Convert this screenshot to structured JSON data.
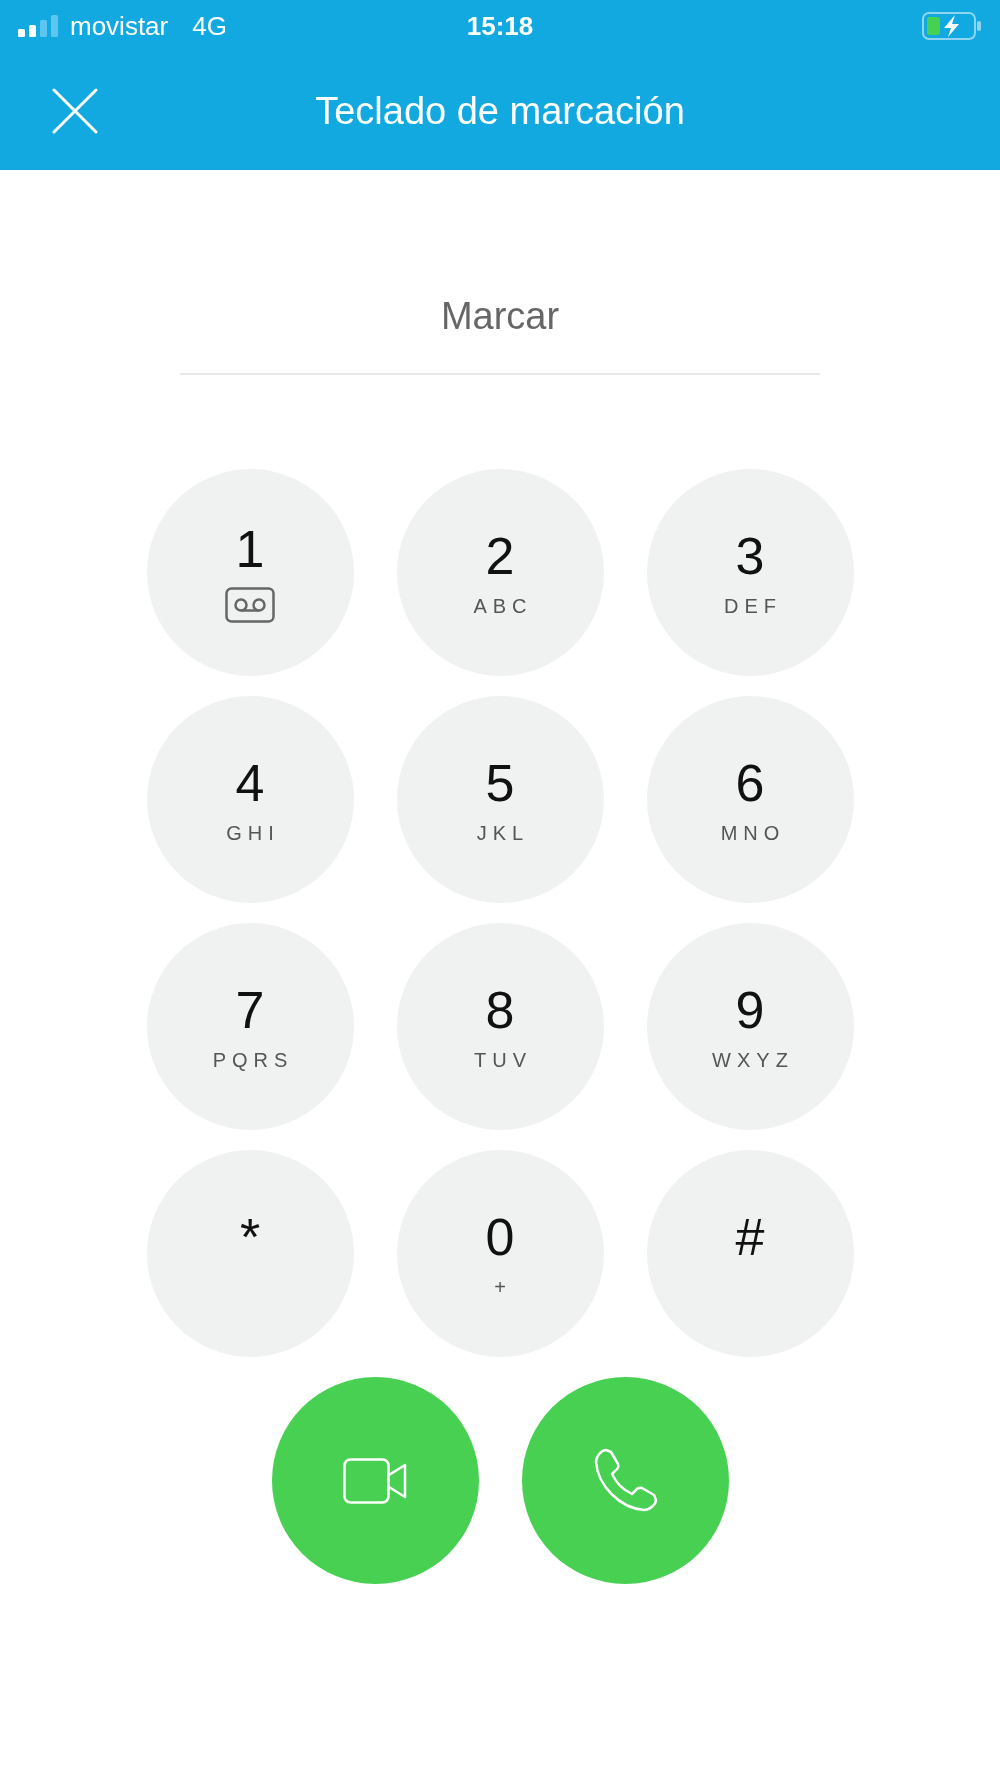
{
  "status_bar": {
    "carrier": "movistar",
    "network": "4G",
    "time": "15:18"
  },
  "header": {
    "title": "Teclado de marcación"
  },
  "dial_field": {
    "placeholder": "Marcar"
  },
  "keys": [
    {
      "digit": "1",
      "kind": "voicemail"
    },
    {
      "digit": "2",
      "kind": "letters",
      "sub": "ABC"
    },
    {
      "digit": "3",
      "kind": "letters",
      "sub": "DEF"
    },
    {
      "digit": "4",
      "kind": "letters",
      "sub": "GHI"
    },
    {
      "digit": "5",
      "kind": "letters",
      "sub": "JKL"
    },
    {
      "digit": "6",
      "kind": "letters",
      "sub": "MNO"
    },
    {
      "digit": "7",
      "kind": "letters",
      "sub": "PQRS"
    },
    {
      "digit": "8",
      "kind": "letters",
      "sub": "TUV"
    },
    {
      "digit": "9",
      "kind": "letters",
      "sub": "WXYZ"
    },
    {
      "digit": "*",
      "kind": "symbol"
    },
    {
      "digit": "0",
      "kind": "letters",
      "sub": "+"
    },
    {
      "digit": "#",
      "kind": "symbol"
    }
  ],
  "call_buttons": [
    {
      "kind": "video"
    },
    {
      "kind": "voice"
    }
  ]
}
